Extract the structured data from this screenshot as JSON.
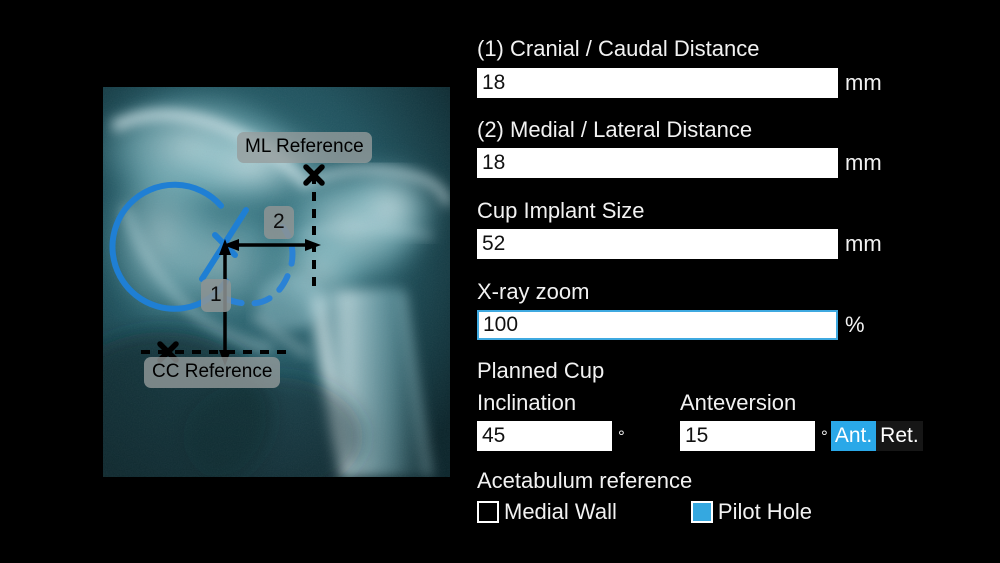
{
  "background_color": "#000000",
  "accent_color": "#2aa8e8",
  "xray": {
    "alt": "pelvis-hip-radiograph",
    "annotations": {
      "ml_reference_label": "ML Reference",
      "cc_reference_label": "CC Reference",
      "badge_1": "1",
      "badge_2": "2"
    },
    "overlay_colors": {
      "cup_outline": "#1f7fd4",
      "measurement_line": "#000000"
    }
  },
  "form": {
    "fields": [
      {
        "key": "cranial_caudal_distance",
        "label": "(1) Cranial / Caudal Distance",
        "value": "18",
        "unit": "mm",
        "focused": false
      },
      {
        "key": "medial_lateral_distance",
        "label": "(2) Medial / Lateral Distance",
        "value": "18",
        "unit": "mm",
        "focused": false
      },
      {
        "key": "cup_implant_size",
        "label": "Cup Implant Size",
        "value": "52",
        "unit": "mm",
        "focused": false
      },
      {
        "key": "xray_zoom",
        "label": "X-ray zoom",
        "value": "100",
        "unit": "%",
        "focused": true
      }
    ],
    "planned_cup": {
      "title": "Planned Cup",
      "inclination": {
        "label": "Inclination",
        "value": "45",
        "unit": "°"
      },
      "anteversion": {
        "label": "Anteversion",
        "value": "15",
        "unit": "°"
      },
      "direction_toggle": {
        "options": [
          "Ant.",
          "Ret."
        ],
        "selected": "Ant."
      }
    },
    "acetabulum_reference": {
      "title": "Acetabulum reference",
      "options": [
        {
          "label": "Medial Wall",
          "checked": false
        },
        {
          "label": "Pilot Hole",
          "checked": true
        }
      ]
    }
  }
}
